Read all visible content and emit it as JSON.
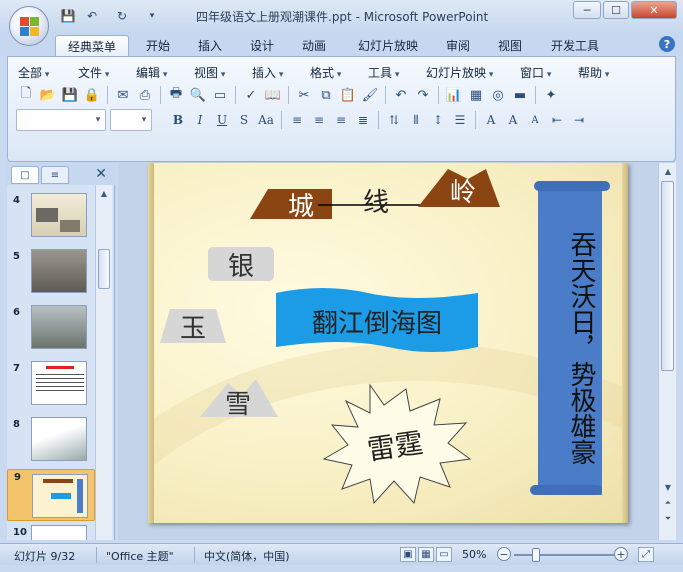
{
  "window": {
    "title": "四年级语文上册观潮课件.ppt - Microsoft PowerPoint",
    "minimize": "─",
    "maximize": "☐",
    "close": "✕"
  },
  "tabs": [
    {
      "label": "经典菜单",
      "active": true
    },
    {
      "label": "开始"
    },
    {
      "label": "插入"
    },
    {
      "label": "设计"
    },
    {
      "label": "动画"
    },
    {
      "label": "幻灯片放映"
    },
    {
      "label": "审阅"
    },
    {
      "label": "视图"
    },
    {
      "label": "开发工具"
    }
  ],
  "help": "?",
  "menus": [
    "全部",
    "文件",
    "编辑",
    "视图",
    "插入",
    "格式",
    "工具",
    "幻灯片放映",
    "窗口",
    "帮助"
  ],
  "panel": {
    "tab_outline": "□",
    "tab_slides": "≡",
    "close": "✕",
    "thumbs": [
      {
        "num": "4"
      },
      {
        "num": "5"
      },
      {
        "num": "6"
      },
      {
        "num": "7"
      },
      {
        "num": "8"
      },
      {
        "num": "9",
        "selected": true
      },
      {
        "num": "10"
      }
    ]
  },
  "slide": {
    "title_left": "城",
    "title_middle": "线",
    "title_right": "岭",
    "label_silver": "银",
    "label_jade": "玉",
    "label_snow": "雪",
    "banner": "翻江倒海图",
    "burst": "雷霆",
    "scroll_text": "吞天沃日，势极雄豪"
  },
  "status": {
    "slide_info": "幻灯片 9/32",
    "theme": "\"Office 主题\"",
    "language": "中文(简体，中国)",
    "zoom": "50%",
    "zoom_minus": "−",
    "zoom_plus": "+"
  },
  "colors": {
    "banner_blue": "#1c9be6",
    "scroll_blue": "#4a7cc7",
    "brown": "#8b4513",
    "grey_label": "#d6d6d6"
  }
}
